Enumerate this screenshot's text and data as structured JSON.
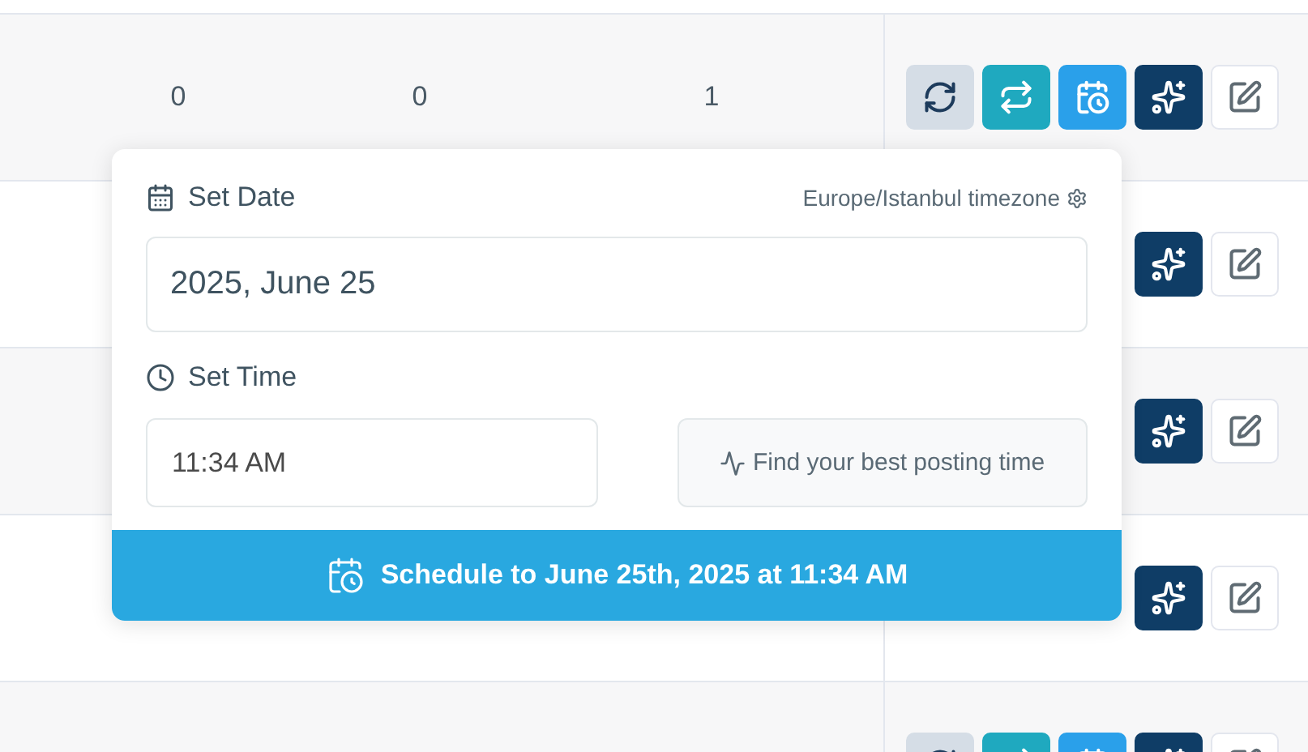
{
  "rows": [
    {
      "cells": [
        "0",
        "0",
        "1"
      ],
      "actions": [
        {
          "kind": "history"
        },
        {
          "kind": "repost"
        },
        {
          "kind": "schedule"
        },
        {
          "kind": "ai"
        },
        {
          "kind": "edit"
        }
      ]
    },
    {
      "cells": [],
      "actions": [
        {
          "kind": "ai"
        },
        {
          "kind": "edit"
        }
      ]
    },
    {
      "cells": [],
      "actions": [
        {
          "kind": "ai"
        },
        {
          "kind": "edit"
        }
      ]
    },
    {
      "cells": [],
      "actions": [
        {
          "kind": "ai"
        },
        {
          "kind": "edit"
        }
      ]
    },
    {
      "cells": [],
      "actions": [
        {
          "kind": "history"
        },
        {
          "kind": "repost"
        },
        {
          "kind": "schedule"
        },
        {
          "kind": "ai"
        },
        {
          "kind": "edit"
        }
      ]
    }
  ],
  "schedule_popover": {
    "date_label": "Set Date",
    "timezone": "Europe/Istanbul timezone",
    "date_value": "2025, June 25",
    "time_label": "Set Time",
    "time_value": "11:34 AM",
    "best_time_button": "Find your best posting time",
    "schedule_button": "Schedule to June 25th, 2025 at 11:34 AM"
  }
}
